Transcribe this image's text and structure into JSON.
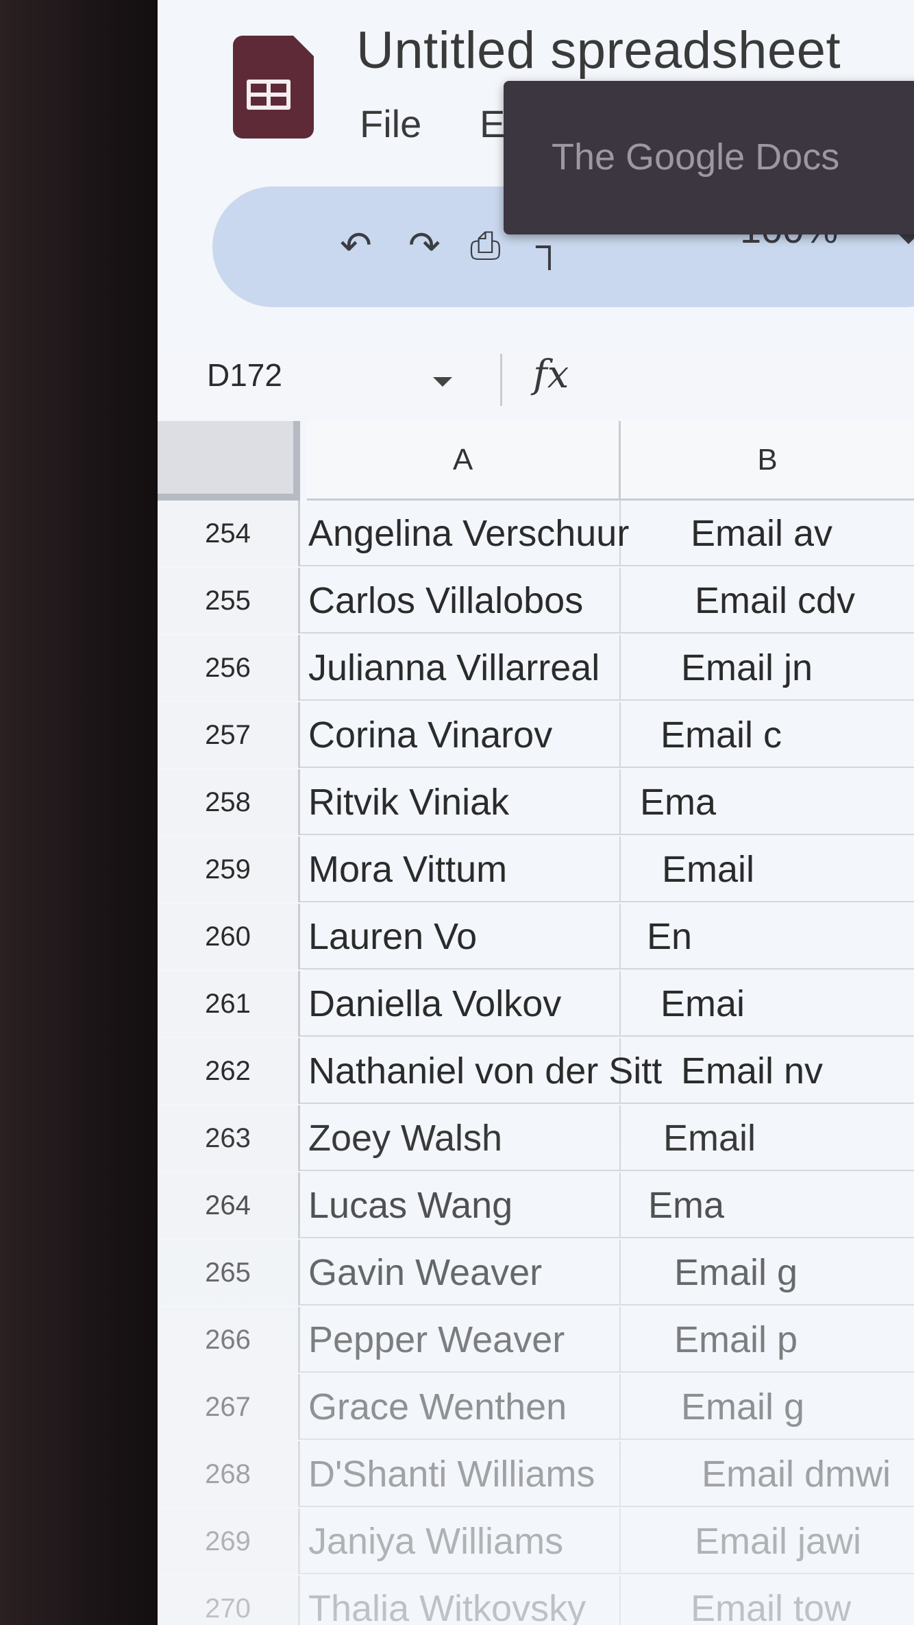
{
  "header": {
    "title": "Untitled spreadsheet",
    "menu": {
      "file": "File",
      "edit": "E"
    }
  },
  "tooltip": {
    "text": "The Google Docs"
  },
  "toolbar": {
    "zoom": "100%"
  },
  "formula_bar": {
    "cell_ref": "D172",
    "fx": "fx"
  },
  "columns": [
    "A",
    "B"
  ],
  "rows": [
    {
      "num": "254",
      "a": "Angelina Verschuur",
      "b": "Email av"
    },
    {
      "num": "255",
      "a": "Carlos Villalobos",
      "b": "Email cdv"
    },
    {
      "num": "256",
      "a": "Julianna Villarreal",
      "b": "Email jn"
    },
    {
      "num": "257",
      "a": "Corina Vinarov",
      "b": "Email c"
    },
    {
      "num": "258",
      "a": "Ritvik Viniak",
      "b": "Ema"
    },
    {
      "num": "259",
      "a": "Mora Vittum",
      "b": "Email"
    },
    {
      "num": "260",
      "a": "Lauren Vo",
      "b": "En"
    },
    {
      "num": "261",
      "a": "Daniella Volkov",
      "b": "Emai"
    },
    {
      "num": "262",
      "a": "Nathaniel von der Sitt",
      "b": "Email nv"
    },
    {
      "num": "263",
      "a": "Zoey Walsh",
      "b": "Email"
    },
    {
      "num": "264",
      "a": "Lucas Wang",
      "b": "Ema"
    },
    {
      "num": "265",
      "a": "Gavin Weaver",
      "b": "Email g"
    },
    {
      "num": "266",
      "a": "Pepper Weaver",
      "b": "Email p"
    },
    {
      "num": "267",
      "a": "Grace Wenthen",
      "b": "Email g"
    },
    {
      "num": "268",
      "a": "D'Shanti Williams",
      "b": "Email dmwi"
    },
    {
      "num": "269",
      "a": "Janiya Williams",
      "b": "Email jawi"
    },
    {
      "num": "270",
      "a": "Thalia Witkovsky",
      "b": "Email tow"
    }
  ]
}
